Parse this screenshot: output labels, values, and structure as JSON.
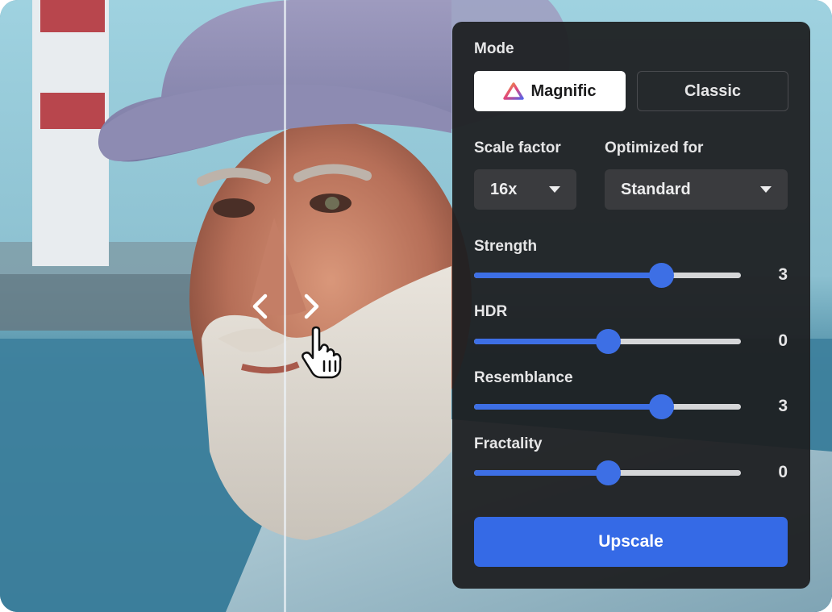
{
  "panel": {
    "mode_label": "Mode",
    "modes": [
      {
        "label": "Magnific",
        "active": true,
        "icon": "magnific-logo-icon"
      },
      {
        "label": "Classic",
        "active": false
      }
    ],
    "scale_factor": {
      "label": "Scale factor",
      "value": "16x"
    },
    "optimized_for": {
      "label": "Optimized for",
      "value": "Standard"
    },
    "sliders": [
      {
        "label": "Strength",
        "value": "3",
        "fraction": 0.7
      },
      {
        "label": "HDR",
        "value": "0",
        "fraction": 0.5
      },
      {
        "label": "Resemblance",
        "value": "3",
        "fraction": 0.7
      },
      {
        "label": "Fractality",
        "value": "0",
        "fraction": 0.5
      }
    ],
    "upscale_label": "Upscale"
  },
  "colors": {
    "accent": "#3d6fe5",
    "panel_bg": "#1e1f21",
    "track": "#d5d6d8"
  },
  "icons": {
    "compare_left": "chevron-left-icon",
    "compare_right": "chevron-right-icon",
    "cursor": "hand-pointer-icon"
  }
}
